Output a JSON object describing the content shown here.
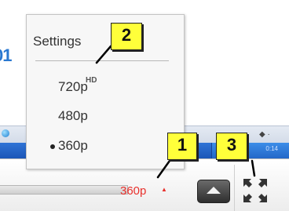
{
  "background": {
    "partial_number": "01"
  },
  "settings_menu": {
    "title": "Settings",
    "options": [
      {
        "label": "720p",
        "badge": "HD",
        "selected": false
      },
      {
        "label": "480p",
        "badge": "",
        "selected": false
      },
      {
        "label": "360p",
        "badge": "",
        "selected": true
      }
    ]
  },
  "controls": {
    "quality_label": "360p",
    "quality_indicator": "▲",
    "eject_icon": "eject-icon",
    "fullscreen_icon": "fullscreen-icon"
  },
  "callouts": [
    {
      "number": "1",
      "target": "quality-button"
    },
    {
      "number": "2",
      "target": "settings-menu"
    },
    {
      "number": "3",
      "target": "fullscreen-button"
    }
  ],
  "colors": {
    "accent_red": "#e8302c",
    "callout_yellow": "#ffff3a",
    "taskbar_blue": "#1c56b7"
  }
}
